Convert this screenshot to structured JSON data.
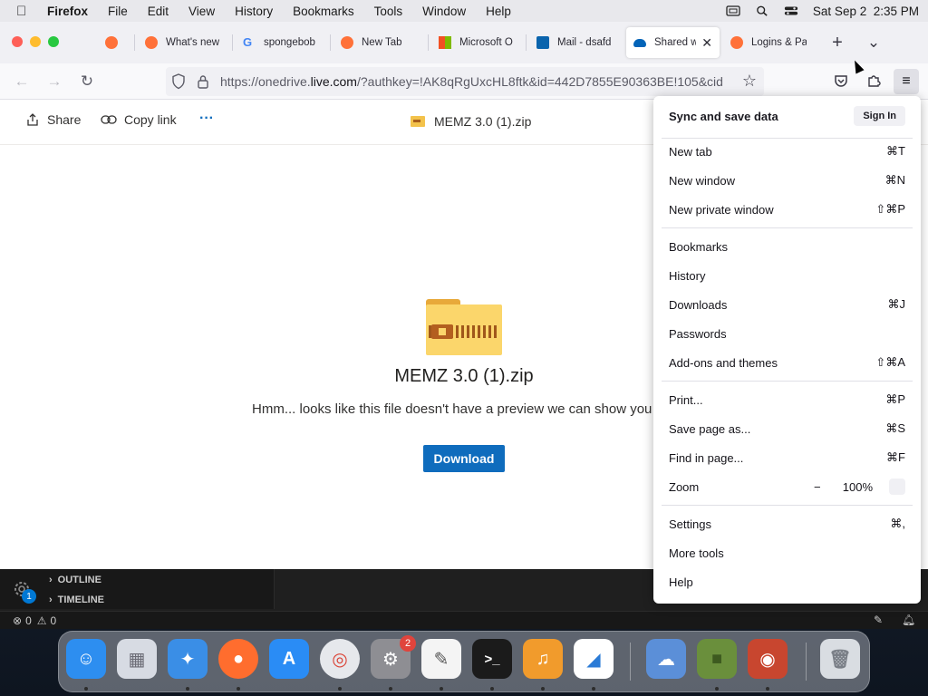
{
  "menubar": {
    "app": "Firefox",
    "items": [
      "File",
      "Edit",
      "View",
      "History",
      "Bookmarks",
      "Tools",
      "Window",
      "Help"
    ],
    "clock": "Sat Sep 2  2:35 PM"
  },
  "tabs": [
    {
      "label": "",
      "icon": "firefox-icon",
      "color": "#ff7139"
    },
    {
      "label": "What's new",
      "icon": "firefox-icon",
      "color": "#ff7139"
    },
    {
      "label": "spongebob",
      "icon": "google-icon",
      "color": "#4285f4"
    },
    {
      "label": "New Tab",
      "icon": "firefox-icon",
      "color": "#ff7139"
    },
    {
      "label": "Microsoft O",
      "icon": "microsoft-icon",
      "color": "#f25022"
    },
    {
      "label": "Mail - dsafd",
      "icon": "outlook-icon",
      "color": "#0a64ad"
    },
    {
      "label": "Shared w",
      "icon": "onedrive-icon",
      "color": "#0364b8",
      "active": true
    },
    {
      "label": "Logins & Pa",
      "icon": "firefox-icon",
      "color": "#ff7139"
    }
  ],
  "urlbar": {
    "prefix": "https://onedrive.",
    "host": "live.com",
    "rest": "/?authkey=!AK8qRgUxcHL8ftk&id=442D7855E90363BE!105&cid"
  },
  "page": {
    "share": "Share",
    "copy_link": "Copy link",
    "more": "···",
    "filename": "MEMZ 3.0 (1).zip",
    "title": "MEMZ 3.0 (1).zip",
    "message": "Hmm... looks like this file doesn't have a preview we can show you.",
    "download": "Download"
  },
  "appmenu": {
    "sync_title": "Sync and save data",
    "sign_in": "Sign In",
    "groups": [
      [
        {
          "label": "New tab",
          "shortcut": "⌘T"
        },
        {
          "label": "New window",
          "shortcut": "⌘N"
        },
        {
          "label": "New private window",
          "shortcut": "⇧⌘P"
        }
      ],
      [
        {
          "label": "Bookmarks",
          "shortcut": ""
        },
        {
          "label": "History",
          "shortcut": ""
        },
        {
          "label": "Downloads",
          "shortcut": "⌘J"
        },
        {
          "label": "Passwords",
          "shortcut": ""
        },
        {
          "label": "Add-ons and themes",
          "shortcut": "⇧⌘A"
        }
      ],
      [
        {
          "label": "Print...",
          "shortcut": "⌘P"
        },
        {
          "label": "Save page as...",
          "shortcut": "⌘S"
        },
        {
          "label": "Find in page...",
          "shortcut": "⌘F"
        }
      ],
      [
        {
          "label": "Settings",
          "shortcut": "⌘,"
        },
        {
          "label": "More tools",
          "shortcut": ""
        },
        {
          "label": "Help",
          "shortcut": ""
        }
      ]
    ],
    "zoom": {
      "label": "Zoom",
      "minus": "−",
      "value": "100%"
    }
  },
  "vscode": {
    "outline": "OUTLINE",
    "timeline": "TIMELINE",
    "errors": "0",
    "warnings": "0",
    "settings_badge": "1"
  },
  "dock": [
    {
      "name": "finder",
      "color": "#2d8ef0",
      "glyph": "☺"
    },
    {
      "name": "launchpad",
      "color": "#d7dbe3",
      "glyph": "▦"
    },
    {
      "name": "safari",
      "color": "#3a8ee6",
      "glyph": "✦"
    },
    {
      "name": "firefox",
      "color": "#ff6d2e",
      "glyph": "●"
    },
    {
      "name": "app-store",
      "color": "#2a8cf5",
      "glyph": "A"
    },
    {
      "name": "chrome",
      "color": "#e6e8ec",
      "glyph": "◎"
    },
    {
      "name": "system-settings",
      "color": "#8e8e93",
      "glyph": "⚙",
      "badge": "2"
    },
    {
      "name": "textedit",
      "color": "#f4f4f4",
      "glyph": "✎"
    },
    {
      "name": "terminal",
      "color": "#1b1b1b",
      "glyph": ">_"
    },
    {
      "name": "garageband",
      "color": "#f19b2c",
      "glyph": "♫"
    },
    {
      "name": "vscode",
      "color": "#ffffff",
      "glyph": "◢"
    },
    {
      "name": "weather",
      "color": "#5b8fd8",
      "glyph": "☁"
    },
    {
      "name": "minecraft",
      "color": "#6a8f3c",
      "glyph": "■"
    },
    {
      "name": "photo-booth",
      "color": "#c8462f",
      "glyph": "◉"
    },
    {
      "name": "trash",
      "color": "#d9dde2",
      "glyph": "🗑"
    }
  ]
}
